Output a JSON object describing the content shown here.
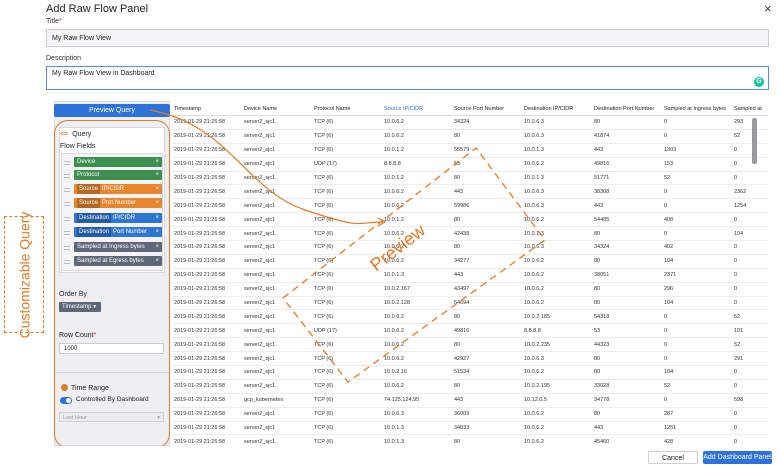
{
  "dialog": {
    "title": "Add Raw Flow Panel",
    "close_icon": "×"
  },
  "form": {
    "title_label": "Title",
    "title_required": "*",
    "title_value": "My Raw Flow View",
    "description_label": "Description",
    "description_value": "My Raw Flow View in Dashboard",
    "grammar_icon": "G"
  },
  "left_panel": {
    "preview_button": "Preview Query",
    "query_code_icon": "<>",
    "query_label": "Query",
    "flow_fields_label": "Flow Fields",
    "fields": [
      {
        "prefix": "",
        "label": "Device",
        "color": "#3d8f4f"
      },
      {
        "prefix": "",
        "label": "Protocol",
        "color": "#3d8f4f"
      },
      {
        "prefix": "Source",
        "label": "IP/CIDR",
        "color": "#e8862f"
      },
      {
        "prefix": "Source",
        "label": "Port Number",
        "color": "#e8862f"
      },
      {
        "prefix": "Destination",
        "label": "IP/CIDR",
        "color": "#2f76d2"
      },
      {
        "prefix": "Destination",
        "label": "Port Number",
        "color": "#2f76d2"
      },
      {
        "prefix": "",
        "label": "Sampled at Ingress bytes",
        "color": "#5d6777"
      },
      {
        "prefix": "",
        "label": "Sampled at Egress bytes",
        "color": "#5d6777"
      }
    ],
    "order_by_label": "Order By",
    "order_by_value": "Timestamp",
    "row_count_label": "Row Count",
    "row_count_required": "*",
    "row_count_value": "1000",
    "time_range_label": "Time Range",
    "controlled_label": "Controlled By Dashboard",
    "time_select_value": "Last Hour"
  },
  "table": {
    "columns": [
      "Timestamp",
      "Device Name",
      "Protocol Name",
      "Source IP/CIDR",
      "Source Port Number",
      "Destination IP/CIDR",
      "Destination Port Number",
      "Sampled at Ingress bytes",
      "Sampled at"
    ],
    "rows": [
      [
        "2019-01-29 21:26:58",
        "server2_sjc1",
        "TCP (6)",
        "10.0.6.2",
        "34324",
        "10.0.6.3",
        "80",
        "0",
        "293"
      ],
      [
        "2019-01-29 21:26:58",
        "server2_sjc1",
        "TCP (6)",
        "10.0.6.2",
        "80",
        "10.0.6.3",
        "41874",
        "0",
        "52"
      ],
      [
        "2019-01-29 21:26:58",
        "server2_sjc1",
        "TCP (6)",
        "10.0.1.2",
        "55579",
        "10.0.1.3",
        "443",
        "1303",
        "0"
      ],
      [
        "2019-01-29 21:26:58",
        "server2_sjc1",
        "UDP (17)",
        "8.8.8.8",
        "53",
        "10.0.6.2",
        "49816",
        "153",
        "0"
      ],
      [
        "2019-01-29 21:26:58",
        "server2_sjc1",
        "TCP (6)",
        "10.0.1.2",
        "80",
        "10.0.1.3",
        "51771",
        "52",
        "0"
      ],
      [
        "2019-01-29 21:26:58",
        "server2_sjc1",
        "TCP (6)",
        "10.0.6.2",
        "443",
        "10.0.6.3",
        "38308",
        "0",
        "2362"
      ],
      [
        "2019-01-29 21:26:58",
        "server2_sjc1",
        "TCP (6)",
        "10.0.6.2",
        "59986",
        "10.0.6.3",
        "443",
        "0",
        "1254"
      ],
      [
        "2019-01-29 21:26:58",
        "server2_sjc1",
        "TCP (6)",
        "10.0.1.2",
        "80",
        "10.0.6.2",
        "54485",
        "408",
        "0"
      ],
      [
        "2019-01-29 21:26:58",
        "server2_sjc1",
        "TCP (6)",
        "10.0.6.2",
        "42438",
        "10.0.1.3",
        "80",
        "0",
        "104"
      ],
      [
        "2019-01-29 21:26:58",
        "server2_sjc1",
        "TCP (6)",
        "10.0.6.2",
        "80",
        "10.0.6.3",
        "34324",
        "402",
        "0"
      ],
      [
        "2019-01-29 21:26:58",
        "server2_sjc1",
        "TCP (6)",
        "10.0.6.2",
        "34277",
        "10.0.6.2",
        "80",
        "104",
        "0"
      ],
      [
        "2019-01-29 21:26:58",
        "server2_sjc1",
        "TCP (6)",
        "10.0.1.3",
        "443",
        "10.0.6.2",
        "38051",
        "2371",
        "0"
      ],
      [
        "2019-01-29 21:26:58",
        "server2_sjc1",
        "TCP (6)",
        "10.0.2.167",
        "43497",
        "10.0.6.2",
        "80",
        "296",
        "0"
      ],
      [
        "2019-01-29 21:26:58",
        "server2_sjc1",
        "TCP (6)",
        "10.0.2.128",
        "54694",
        "10.0.6.2",
        "80",
        "104",
        "0"
      ],
      [
        "2019-01-29 21:26:58",
        "server2_sjc1",
        "TCP (6)",
        "10.0.6.2",
        "80",
        "10.0.2.185",
        "54318",
        "0",
        "52"
      ],
      [
        "2019-01-29 21:26:58",
        "server2_sjc1",
        "UDP (17)",
        "10.0.6.2",
        "49816",
        "8.8.8.8",
        "53",
        "0",
        "101"
      ],
      [
        "2019-01-29 21:26:58",
        "server2_sjc1",
        "TCP (6)",
        "10.0.6.2",
        "80",
        "10.0.2.235",
        "44323",
        "0",
        "52"
      ],
      [
        "2019-01-29 21:26:58",
        "server2_sjc1",
        "TCP (6)",
        "10.0.6.2",
        "42927",
        "10.0.6.3",
        "80",
        "0",
        "291"
      ],
      [
        "2019-01-29 21:26:58",
        "server2_sjc1",
        "TCP (6)",
        "10.0.2.16",
        "51534",
        "10.0.6.2",
        "80",
        "104",
        "0"
      ],
      [
        "2019-01-29 21:26:58",
        "server2_sjc1",
        "TCP (6)",
        "10.0.6.2",
        "80",
        "10.0.2.195",
        "33028",
        "52",
        "0"
      ],
      [
        "2019-01-29 21:26:58",
        "gcp_kubernetes",
        "TCP (6)",
        "74.125.124.95",
        "443",
        "10.12.0.5",
        "34778",
        "0",
        "598"
      ],
      [
        "2019-01-29 21:26:58",
        "server2_sjc1",
        "TCP (6)",
        "10.0.6.3",
        "36009",
        "10.0.6.2",
        "80",
        "287",
        "0"
      ],
      [
        "2019-01-29 21:26:58",
        "server2_sjc1",
        "TCP (6)",
        "10.0.1.3",
        "34033",
        "10.0.6.2",
        "443",
        "1251",
        "0"
      ],
      [
        "2019-01-29 21:26:58",
        "server2_sjc1",
        "TCP (6)",
        "10.0.1.3",
        "80",
        "10.0.6.2",
        "45460",
        "428",
        "0"
      ],
      [
        "2019-01-29 21:26:58",
        "server2_sjc1",
        "TCP (6)",
        "10.0.2.2",
        "51135",
        "10.0.6.2",
        "80",
        "296",
        "0"
      ]
    ]
  },
  "annotations": {
    "left_label": "Customizable Query",
    "preview_label": "Preview",
    "color": "#e07b2a"
  },
  "footer": {
    "cancel_button": "Cancel",
    "add_button": "Add Dashboard Panel"
  }
}
